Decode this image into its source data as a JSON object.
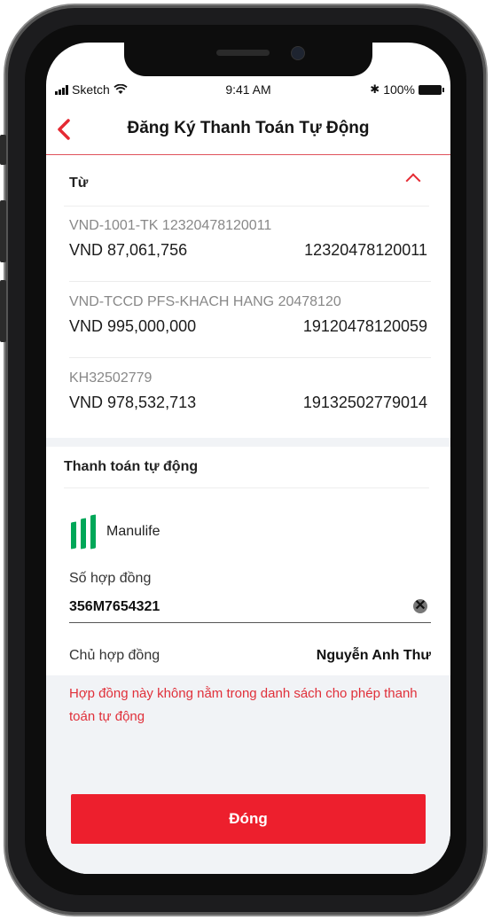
{
  "status_bar": {
    "carrier": "Sketch",
    "time": "9:41 AM",
    "battery": "100%"
  },
  "header": {
    "title": "Đăng Ký Thanh Toán Tự Động"
  },
  "from": {
    "label": "Từ",
    "accounts": [
      {
        "name": "VND-1001-TK 12320478120011",
        "balance": "VND 87,061,756",
        "number": "12320478120011"
      },
      {
        "name": "VND-TCCD PFS-KHACH HANG 20478120",
        "balance": "VND 995,000,000",
        "number": "19120478120059"
      },
      {
        "name": "KH32502779",
        "balance": "VND 978,532,713",
        "number": "19132502779014"
      }
    ]
  },
  "auto_pay": {
    "title": "Thanh toán tự động",
    "provider": "Manulife",
    "contract_label": "Số hợp đồng",
    "contract_value": "356M7654321",
    "holder_label": "Chủ hợp đồng",
    "holder_value": "Nguyễn Anh Thư"
  },
  "error": {
    "message": "Hợp đồng này không nằm trong danh sách cho phép thanh toán tự động"
  },
  "actions": {
    "close_label": "Đóng"
  },
  "colors": {
    "accent": "#ed1f2d",
    "error": "#e0303a",
    "brand_green": "#00a758",
    "panel_bg": "#f1f3f6"
  }
}
